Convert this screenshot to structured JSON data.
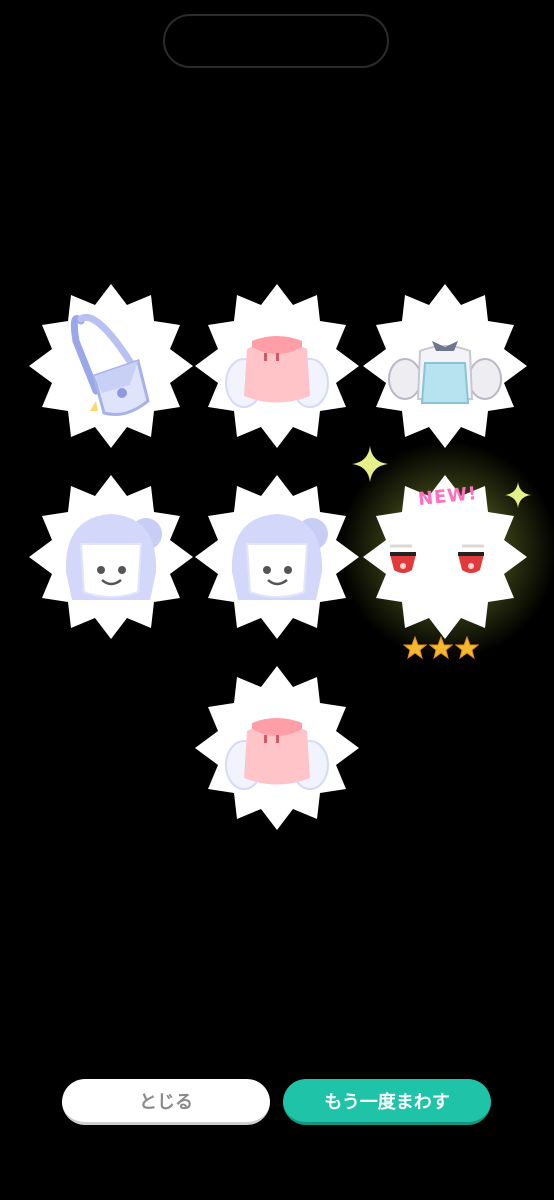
{
  "buttons": {
    "close_label": "とじる",
    "spin_again_label": "もう一度まわす"
  },
  "rewards": [
    {
      "item": "shoulder-bag",
      "is_new": false
    },
    {
      "item": "pink-top",
      "is_new": false
    },
    {
      "item": "blue-overalls-outfit",
      "is_new": false
    },
    {
      "item": "bun-hairstyle",
      "is_new": false
    },
    {
      "item": "bun-hairstyle",
      "is_new": false
    },
    {
      "item": "red-eyes",
      "is_new": true,
      "new_label": "NEW!",
      "rarity_stars": 3
    },
    {
      "item": "pink-top",
      "is_new": false
    }
  ],
  "colors": {
    "background": "#000000",
    "badge": "#ffffff",
    "accent_button": "#1fc4a8",
    "new_label": "#ff6fbf",
    "star": "#f7b731"
  }
}
